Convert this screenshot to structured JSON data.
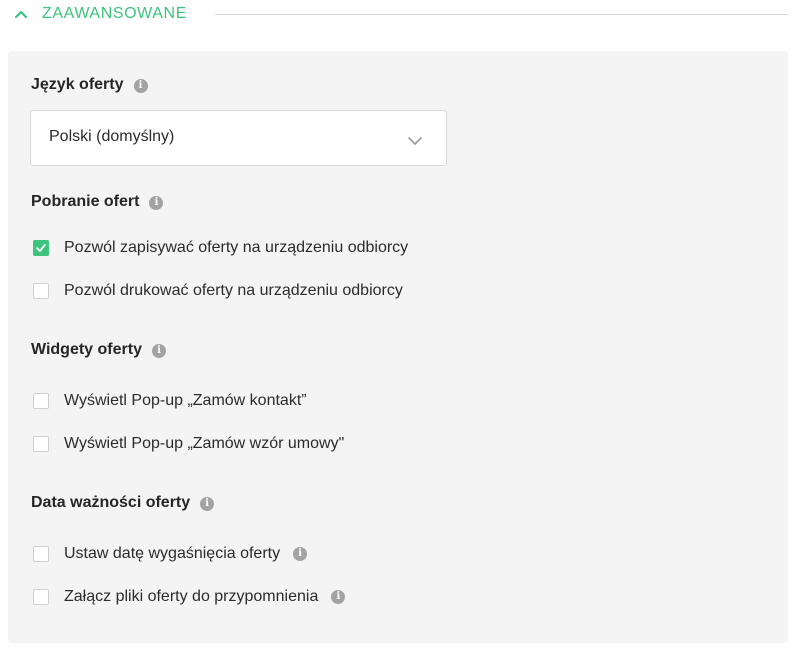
{
  "header": {
    "title": "ZAAWANSOWANE",
    "accent_color": "#3cc47c",
    "toggle_icon": "chevron-up-icon"
  },
  "panel": {
    "language": {
      "label": "Język oferty",
      "info_icon": "info-icon",
      "select_value": "Polski (domyślny)",
      "select_icon": "chevron-down-icon"
    },
    "download": {
      "label": "Pobranie ofert",
      "info_icon": "info-icon",
      "options": [
        {
          "label": "Pozwól zapisywać oferty na urządzeniu odbiorcy",
          "checked": true
        },
        {
          "label": "Pozwól drukować oferty na urządzeniu odbiorcy",
          "checked": false
        }
      ]
    },
    "widgets": {
      "label": "Widgety oferty",
      "info_icon": "info-icon",
      "options": [
        {
          "label": "Wyświetl Pop-up „Zamów kontakt”",
          "checked": false
        },
        {
          "label": "Wyświetl Pop-up „Zamów wzór umowy\"",
          "checked": false
        }
      ]
    },
    "expiry": {
      "label": "Data ważności oferty",
      "info_icon": "info-icon",
      "options": [
        {
          "label": "Ustaw datę wygaśnięcia oferty",
          "checked": false,
          "has_info": true
        },
        {
          "label": "Załącz pliki oferty do przypomnienia",
          "checked": false,
          "has_info": true
        }
      ]
    }
  },
  "info_glyph": "i"
}
